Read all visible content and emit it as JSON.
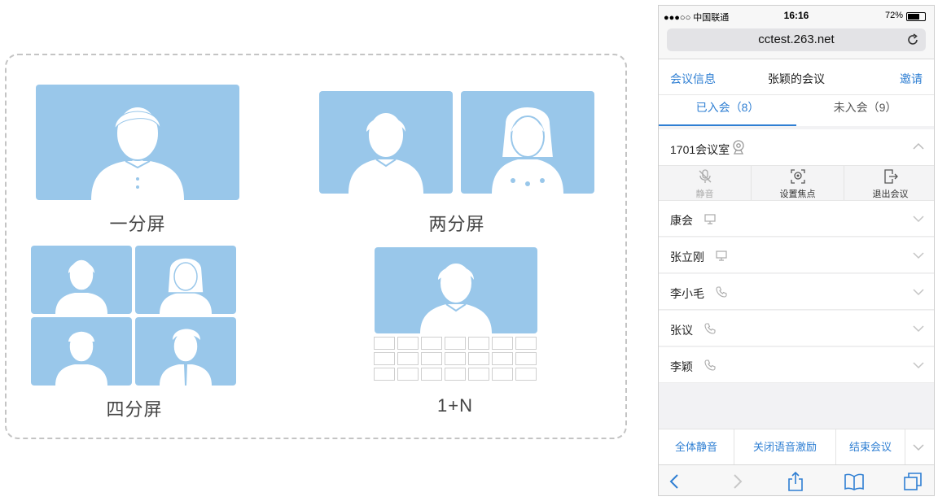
{
  "layouts": {
    "one": "一分屏",
    "two": "两分屏",
    "four": "四分屏",
    "one_plus_n": "1+N"
  },
  "phone": {
    "status": {
      "carrier": "●●●○○ 中国联通",
      "time": "16:16",
      "battery": "72%",
      "battery_level": 0.72
    },
    "url": "cctest.263.net",
    "nav": {
      "left": "会议信息",
      "title": "张颖的会议",
      "right": "邀请"
    },
    "tabs": [
      {
        "label": "已入会（8）"
      },
      {
        "label": "未入会（9）"
      }
    ],
    "room": {
      "name": "1701会议室"
    },
    "room_actions": [
      {
        "label": "静音"
      },
      {
        "label": "设置焦点"
      },
      {
        "label": "退出会议"
      }
    ],
    "members": [
      {
        "name": "康会",
        "device": "screen"
      },
      {
        "name": "张立刚",
        "device": "screen"
      },
      {
        "name": "李小毛",
        "device": "phone"
      },
      {
        "name": "张议",
        "device": "phone"
      },
      {
        "name": "李颖",
        "device": "phone"
      }
    ],
    "bottom_actions": [
      {
        "label": "全体静音"
      },
      {
        "label": "关闭语音激励"
      },
      {
        "label": "结束会议"
      }
    ],
    "colors": {
      "accent": "#2f7fd3",
      "tile": "#99c7ea"
    }
  }
}
